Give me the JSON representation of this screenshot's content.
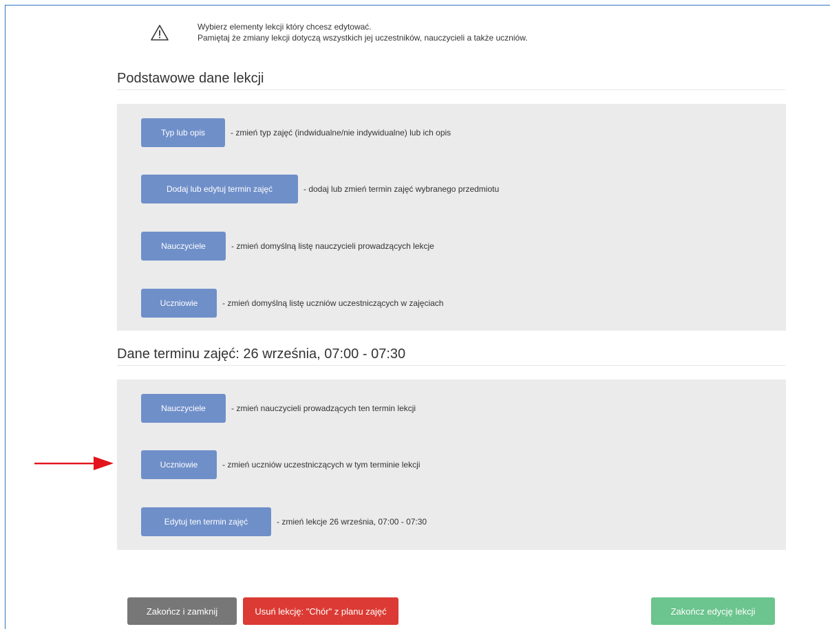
{
  "colors": {
    "frame_border": "#2e74c0",
    "primary_button": "#6f8fc9",
    "close_button": "#777777",
    "delete_button": "#db3b34",
    "finish_button": "#6cc48e",
    "panel_bg": "#ebebeb",
    "arrow": "#e3141b"
  },
  "notice": {
    "icon": "warning-triangle-icon",
    "line1": "Wybierz elementy lekcji który chcesz edytować.",
    "line2": "Pamiętaj że zmiany lekcji dotyczą wszystkich jej uczestników, nauczycieli a także uczniów."
  },
  "basic_section": {
    "title": "Podstawowe dane lekcji",
    "rows": [
      {
        "button": "Typ lub opis",
        "description": "- zmień typ zajęć (indwidualne/nie indywidualne) lub ich opis"
      },
      {
        "button": "Dodaj lub edytuj termin zajęć",
        "description": "- dodaj lub zmień termin zajęć wybranego przedmiotu"
      },
      {
        "button": "Nauczyciele",
        "description": "- zmień domyślną listę nauczycieli prowadzących lekcje"
      },
      {
        "button": "Uczniowie",
        "description": "- zmień domyślną listę uczniów uczestniczących w zajęciach"
      }
    ]
  },
  "term_section": {
    "title": "Dane terminu zajęć: 26 września, 07:00 - 07:30",
    "rows": [
      {
        "button": "Nauczyciele",
        "description": "- zmień nauczycieli prowadzących ten termin lekcji"
      },
      {
        "button": "Uczniowie",
        "description": "- zmień uczniów uczestniczących w tym terminie lekcji"
      },
      {
        "button": "Edytuj ten termin zajęć",
        "description": "- zmień lekcje 26 września, 07:00 - 07:30"
      }
    ]
  },
  "footer": {
    "close_label": "Zakończ i zamknij",
    "delete_label": "Usuń lekcję: \"Chór\" z planu zajęć",
    "finish_label": "Zakończ edycję lekcji"
  }
}
